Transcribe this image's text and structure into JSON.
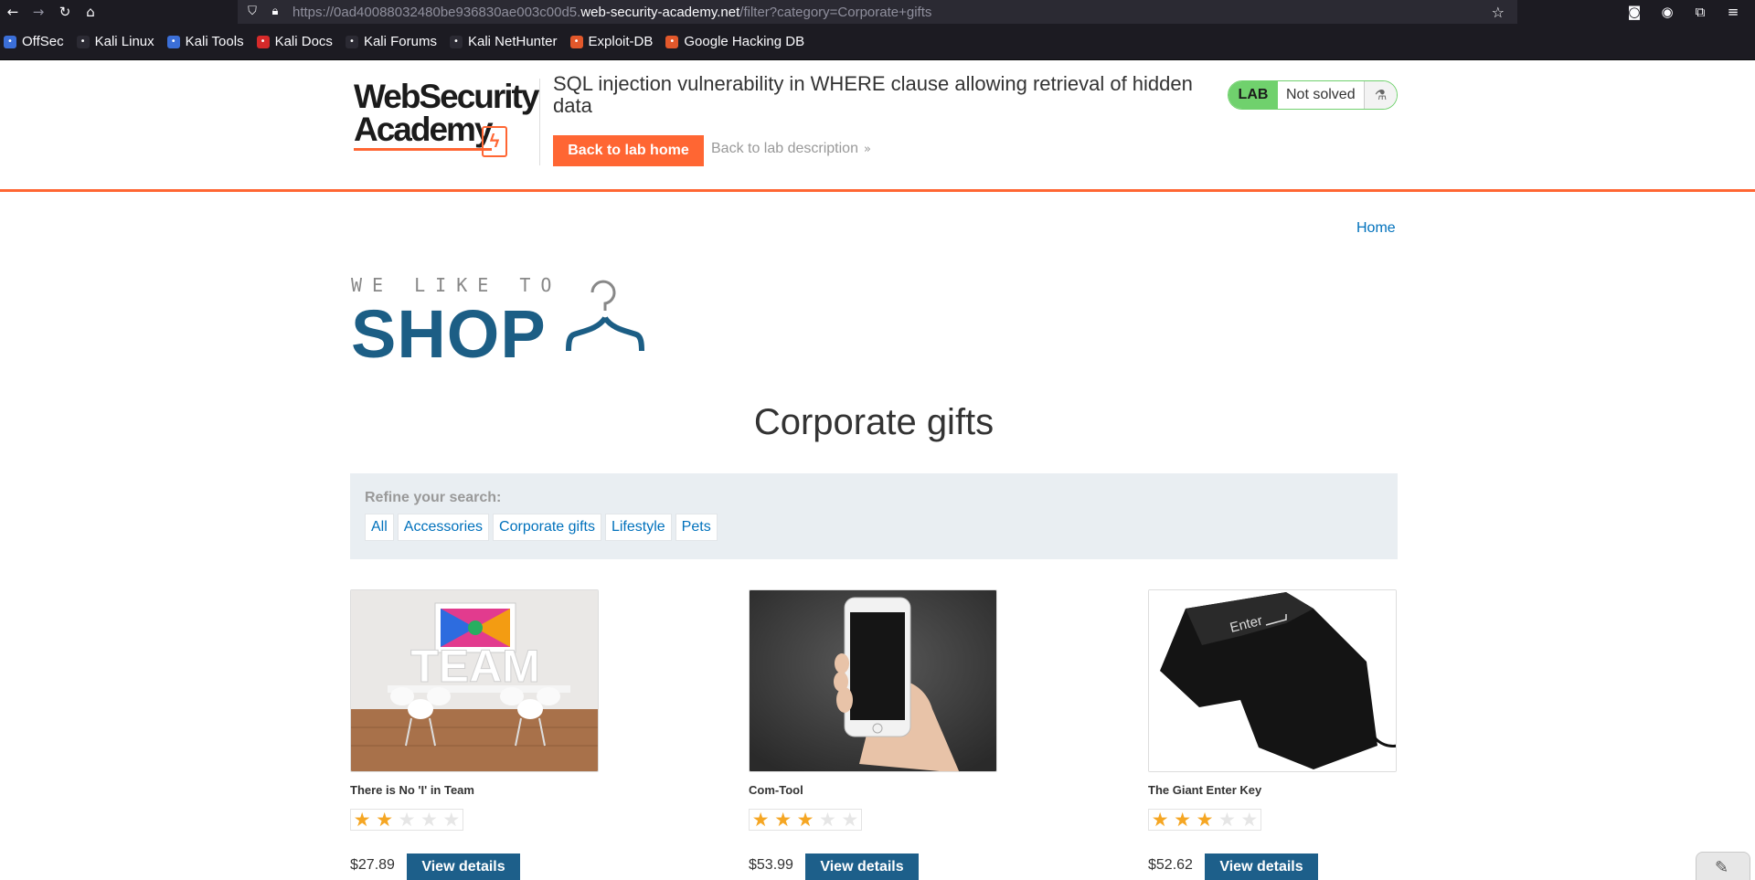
{
  "browser": {
    "url_prefix": "https://0ad40088032480be936830ae003c00d5.",
    "url_domain": "web-security-academy.net",
    "url_path": "/filter?category=Corporate+gifts",
    "bookmarks": [
      {
        "label": "OffSec",
        "icon": "offsec-icon",
        "color": "#3b6fd8"
      },
      {
        "label": "Kali Linux",
        "icon": "kali-dragon-icon",
        "color": "#2b2a33"
      },
      {
        "label": "Kali Tools",
        "icon": "kali-tools-icon",
        "color": "#3b6fd8"
      },
      {
        "label": "Kali Docs",
        "icon": "kali-docs-icon",
        "color": "#d62a2a"
      },
      {
        "label": "Kali Forums",
        "icon": "kali-dragon-icon",
        "color": "#2b2a33"
      },
      {
        "label": "Kali NetHunter",
        "icon": "kali-dragon-icon",
        "color": "#2b2a33"
      },
      {
        "label": "Exploit-DB",
        "icon": "exploitdb-icon",
        "color": "#e2582b"
      },
      {
        "label": "Google Hacking DB",
        "icon": "ghdb-icon",
        "color": "#e2582b"
      }
    ]
  },
  "lab": {
    "logo_line1": "WebSecurity",
    "logo_line2": "Academy",
    "title": "SQL injection vulnerability in WHERE clause allowing retrieval of hidden data",
    "back_home_label": "Back to lab home",
    "back_desc_label": "Back to lab description",
    "status_badge": "LAB",
    "status_text": "Not solved",
    "accent_color": "#ff6633",
    "solved_color": "#70d16d"
  },
  "page": {
    "home_link": "Home",
    "shop_small": "WE LIKE TO",
    "shop_big": "SHOP",
    "category_title": "Corporate gifts"
  },
  "filter": {
    "label": "Refine your search:",
    "options": [
      "All",
      "Accessories",
      "Corporate gifts",
      "Lifestyle",
      "Pets"
    ]
  },
  "products": [
    {
      "name": "There is No 'I' in Team",
      "rating": 2,
      "price": "$27.89",
      "button": "View details"
    },
    {
      "name": "Com-Tool",
      "rating": 3,
      "price": "$53.99",
      "button": "View details"
    },
    {
      "name": "The Giant Enter Key",
      "rating": 3,
      "price": "$52.62",
      "button": "View details"
    }
  ]
}
